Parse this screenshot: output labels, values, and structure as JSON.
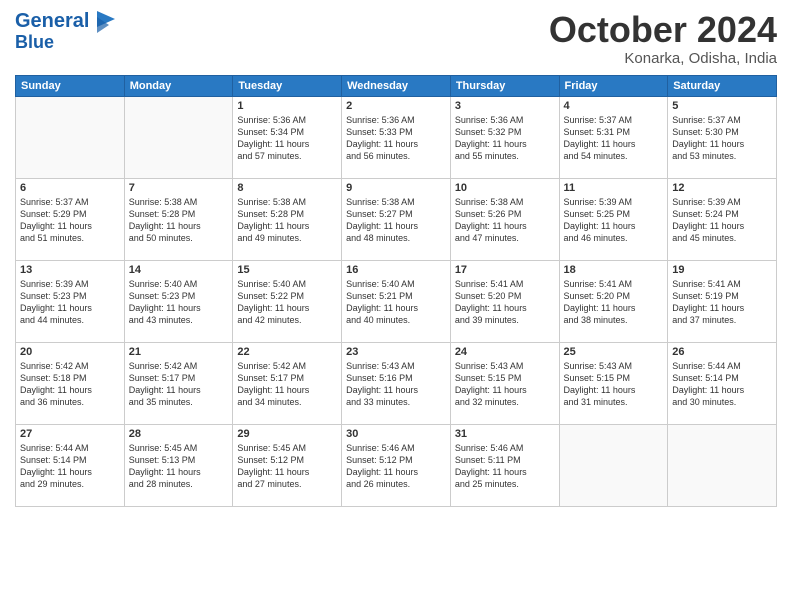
{
  "header": {
    "logo_line1": "General",
    "logo_line2": "Blue",
    "month_title": "October 2024",
    "location": "Konarka, Odisha, India"
  },
  "days_of_week": [
    "Sunday",
    "Monday",
    "Tuesday",
    "Wednesday",
    "Thursday",
    "Friday",
    "Saturday"
  ],
  "weeks": [
    [
      {
        "day": "",
        "content": ""
      },
      {
        "day": "",
        "content": ""
      },
      {
        "day": "1",
        "content": "Sunrise: 5:36 AM\nSunset: 5:34 PM\nDaylight: 11 hours\nand 57 minutes."
      },
      {
        "day": "2",
        "content": "Sunrise: 5:36 AM\nSunset: 5:33 PM\nDaylight: 11 hours\nand 56 minutes."
      },
      {
        "day": "3",
        "content": "Sunrise: 5:36 AM\nSunset: 5:32 PM\nDaylight: 11 hours\nand 55 minutes."
      },
      {
        "day": "4",
        "content": "Sunrise: 5:37 AM\nSunset: 5:31 PM\nDaylight: 11 hours\nand 54 minutes."
      },
      {
        "day": "5",
        "content": "Sunrise: 5:37 AM\nSunset: 5:30 PM\nDaylight: 11 hours\nand 53 minutes."
      }
    ],
    [
      {
        "day": "6",
        "content": "Sunrise: 5:37 AM\nSunset: 5:29 PM\nDaylight: 11 hours\nand 51 minutes."
      },
      {
        "day": "7",
        "content": "Sunrise: 5:38 AM\nSunset: 5:28 PM\nDaylight: 11 hours\nand 50 minutes."
      },
      {
        "day": "8",
        "content": "Sunrise: 5:38 AM\nSunset: 5:28 PM\nDaylight: 11 hours\nand 49 minutes."
      },
      {
        "day": "9",
        "content": "Sunrise: 5:38 AM\nSunset: 5:27 PM\nDaylight: 11 hours\nand 48 minutes."
      },
      {
        "day": "10",
        "content": "Sunrise: 5:38 AM\nSunset: 5:26 PM\nDaylight: 11 hours\nand 47 minutes."
      },
      {
        "day": "11",
        "content": "Sunrise: 5:39 AM\nSunset: 5:25 PM\nDaylight: 11 hours\nand 46 minutes."
      },
      {
        "day": "12",
        "content": "Sunrise: 5:39 AM\nSunset: 5:24 PM\nDaylight: 11 hours\nand 45 minutes."
      }
    ],
    [
      {
        "day": "13",
        "content": "Sunrise: 5:39 AM\nSunset: 5:23 PM\nDaylight: 11 hours\nand 44 minutes."
      },
      {
        "day": "14",
        "content": "Sunrise: 5:40 AM\nSunset: 5:23 PM\nDaylight: 11 hours\nand 43 minutes."
      },
      {
        "day": "15",
        "content": "Sunrise: 5:40 AM\nSunset: 5:22 PM\nDaylight: 11 hours\nand 42 minutes."
      },
      {
        "day": "16",
        "content": "Sunrise: 5:40 AM\nSunset: 5:21 PM\nDaylight: 11 hours\nand 40 minutes."
      },
      {
        "day": "17",
        "content": "Sunrise: 5:41 AM\nSunset: 5:20 PM\nDaylight: 11 hours\nand 39 minutes."
      },
      {
        "day": "18",
        "content": "Sunrise: 5:41 AM\nSunset: 5:20 PM\nDaylight: 11 hours\nand 38 minutes."
      },
      {
        "day": "19",
        "content": "Sunrise: 5:41 AM\nSunset: 5:19 PM\nDaylight: 11 hours\nand 37 minutes."
      }
    ],
    [
      {
        "day": "20",
        "content": "Sunrise: 5:42 AM\nSunset: 5:18 PM\nDaylight: 11 hours\nand 36 minutes."
      },
      {
        "day": "21",
        "content": "Sunrise: 5:42 AM\nSunset: 5:17 PM\nDaylight: 11 hours\nand 35 minutes."
      },
      {
        "day": "22",
        "content": "Sunrise: 5:42 AM\nSunset: 5:17 PM\nDaylight: 11 hours\nand 34 minutes."
      },
      {
        "day": "23",
        "content": "Sunrise: 5:43 AM\nSunset: 5:16 PM\nDaylight: 11 hours\nand 33 minutes."
      },
      {
        "day": "24",
        "content": "Sunrise: 5:43 AM\nSunset: 5:15 PM\nDaylight: 11 hours\nand 32 minutes."
      },
      {
        "day": "25",
        "content": "Sunrise: 5:43 AM\nSunset: 5:15 PM\nDaylight: 11 hours\nand 31 minutes."
      },
      {
        "day": "26",
        "content": "Sunrise: 5:44 AM\nSunset: 5:14 PM\nDaylight: 11 hours\nand 30 minutes."
      }
    ],
    [
      {
        "day": "27",
        "content": "Sunrise: 5:44 AM\nSunset: 5:14 PM\nDaylight: 11 hours\nand 29 minutes."
      },
      {
        "day": "28",
        "content": "Sunrise: 5:45 AM\nSunset: 5:13 PM\nDaylight: 11 hours\nand 28 minutes."
      },
      {
        "day": "29",
        "content": "Sunrise: 5:45 AM\nSunset: 5:12 PM\nDaylight: 11 hours\nand 27 minutes."
      },
      {
        "day": "30",
        "content": "Sunrise: 5:46 AM\nSunset: 5:12 PM\nDaylight: 11 hours\nand 26 minutes."
      },
      {
        "day": "31",
        "content": "Sunrise: 5:46 AM\nSunset: 5:11 PM\nDaylight: 11 hours\nand 25 minutes."
      },
      {
        "day": "",
        "content": ""
      },
      {
        "day": "",
        "content": ""
      }
    ]
  ]
}
